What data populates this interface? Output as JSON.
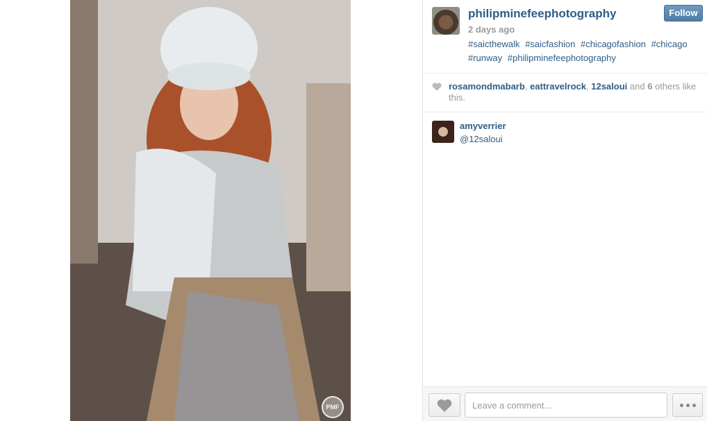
{
  "post": {
    "username": "philipminefeephotography",
    "follow_label": "Follow",
    "timestamp": "2 days ago",
    "caption_tags": [
      "#saicthewalk",
      "#saicfashion",
      "#chicagofashion",
      "#chicago",
      "#runway",
      "#philipminefeephotography"
    ],
    "watermark": "PMF"
  },
  "likes": {
    "users": [
      "rosamondmabarb",
      "eattravelrock",
      "12saloui"
    ],
    "sep": ", ",
    "and": " and ",
    "others_count": "6",
    "others_suffix": " others like this."
  },
  "comments": [
    {
      "user": "amyverrier",
      "text": "@12saloui"
    }
  ],
  "footer": {
    "comment_placeholder": "Leave a comment..."
  },
  "colors": {
    "link": "#2c5d87",
    "follow": "#4f7ca6",
    "muted": "#999999"
  },
  "icons": [
    "heart-icon",
    "more-dots-icon"
  ]
}
